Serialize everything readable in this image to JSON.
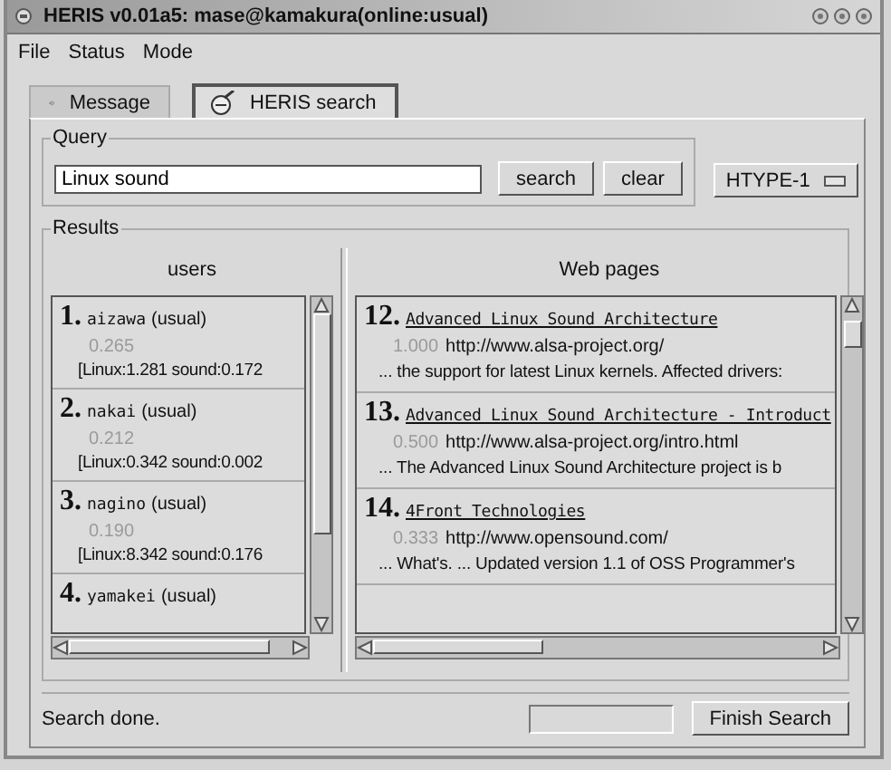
{
  "window": {
    "title": "HERIS v0.01a5: mase@kamakura(online:usual)"
  },
  "menu": [
    "File",
    "Status",
    "Mode"
  ],
  "tabs": [
    {
      "label": "Message",
      "selected": false,
      "kind": "message"
    },
    {
      "label": "HERIS search",
      "selected": true,
      "kind": "search"
    }
  ],
  "query": {
    "legend": "Query",
    "value": "Linux sound",
    "buttons": [
      "search",
      "clear"
    ],
    "type_menu": "HTYPE-1"
  },
  "results": {
    "legend": "Results",
    "users": {
      "heading": "users",
      "items": [
        {
          "rank": "1.",
          "name": "aizawa",
          "mode": "(usual)",
          "score": "0.265",
          "terms": "[Linux:1.281 sound:0.172"
        },
        {
          "rank": "2.",
          "name": "nakai",
          "mode": "(usual)",
          "score": "0.212",
          "terms": "[Linux:0.342 sound:0.002"
        },
        {
          "rank": "3.",
          "name": "nagino",
          "mode": "(usual)",
          "score": "0.190",
          "terms": "[Linux:8.342 sound:0.176"
        },
        {
          "rank": "4.",
          "name": "yamakei",
          "mode": "(usual)"
        }
      ]
    },
    "web_pages": {
      "heading": "Web pages",
      "items": [
        {
          "rank": "12.",
          "title": "Advanced Linux Sound Architecture",
          "score": "1.000",
          "url": "http://www.alsa-project.org/",
          "snippet": "... the support for latest Linux kernels. Affected drivers:"
        },
        {
          "rank": "13.",
          "title": "Advanced Linux Sound Architecture - Introduct",
          "score": "0.500",
          "url": "http://www.alsa-project.org/intro.html",
          "snippet": "... The Advanced Linux Sound Architecture project is b"
        },
        {
          "rank": "14.",
          "title": "4Front Technologies",
          "score": "0.333",
          "url": "http://www.opensound.com/",
          "snippet": "... What's. ... Updated version 1.1 of OSS Programmer's"
        }
      ]
    }
  },
  "status_bar": {
    "message": "Search done.",
    "button": "Finish Search"
  }
}
